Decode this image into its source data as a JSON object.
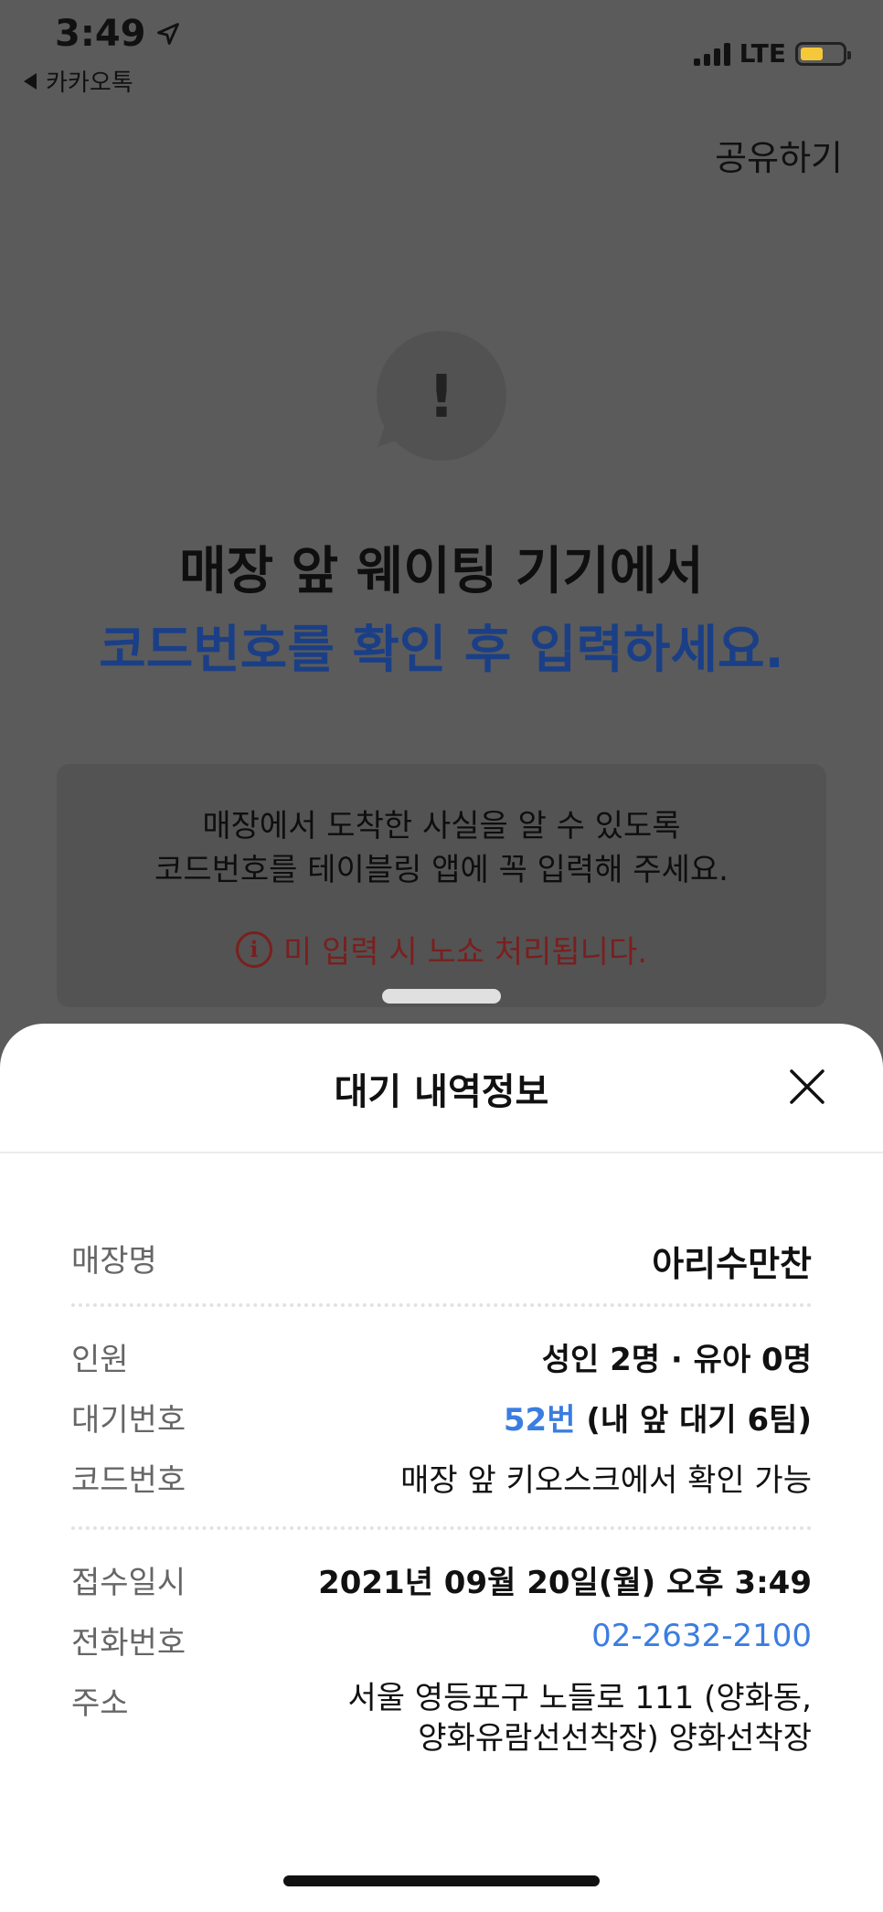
{
  "status_bar": {
    "time": "3:49",
    "back_app": "카카오톡",
    "network": "LTE",
    "battery_color": "#f5c83a",
    "battery_level": 0.55
  },
  "header": {
    "share_label": "공유하기"
  },
  "alert": {
    "icon": "exclamation-bubble-icon",
    "mark": "!",
    "headline_line1": "매장 앞 웨이팅 기기에서",
    "headline_line2": "코드번호를 확인 후 입력하세요.",
    "headline_accent": "#1b3f86"
  },
  "info_box": {
    "line1": "매장에서 도착한 사실을 알 수 있도록",
    "line2": "코드번호를 테이블링 앱에 꼭 입력해 주세요.",
    "warning": "미 입력 시 노쇼 처리됩니다.",
    "warning_icon": "i",
    "warning_color": "#7a1f1f"
  },
  "sheet": {
    "title": "대기 내역정보",
    "close_icon": "close-icon",
    "store": {
      "label": "매장명",
      "value": "아리수만찬"
    },
    "party": {
      "label": "인원",
      "value": "성인 2명 · 유아 0명"
    },
    "wait": {
      "label": "대기번호",
      "number": "52번",
      "detail": "(내 앞 대기 6팀)"
    },
    "code": {
      "label": "코드번호",
      "value": "매장 앞 키오스크에서 확인 가능"
    },
    "received": {
      "label": "접수일시",
      "value": "2021년 09월 20일(월) 오후 3:49"
    },
    "phone": {
      "label": "전화번호",
      "value": "02-2632-2100"
    },
    "address": {
      "label": "주소",
      "line1": "서울 영등포구 노들로 111 (양화동,",
      "line2": "양화유람선선착장) 양화선착장"
    },
    "link_color": "#3b7de0"
  }
}
